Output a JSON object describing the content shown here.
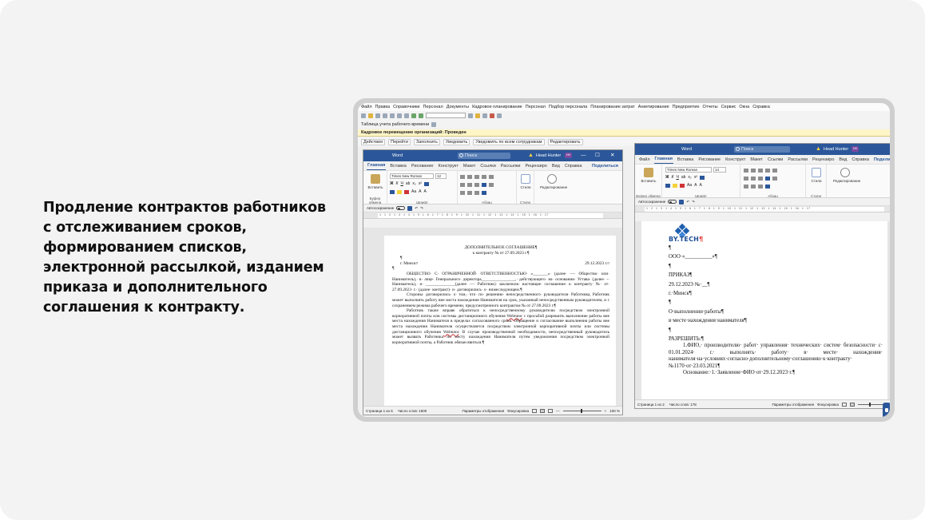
{
  "headline": "Продление контрактов работников\nс отслеживанием сроков,\nформированием списков,\nэлектронной рассылкой, изданием\nприказа и дополнительного\nсоглашения к контракту.",
  "host_app": {
    "menu": [
      "Файл",
      "Правка",
      "Справочники",
      "Персонал",
      "Документы",
      "Кадровое планирование",
      "Персонал",
      "Подбор персонала",
      "Планирование затрат",
      "Анкетирование",
      "Предприятие",
      "Отчеты",
      "Сервис",
      "Окна",
      "Справка"
    ],
    "toolbar2_label": "Таблица учета рабочего времени",
    "subwindow_title": "Кадровое перемещение организаций: Проведен",
    "subwindow_actions": [
      "Действия",
      "Перейти",
      "Заполнить",
      "Уведомить",
      "Уведомить по всем сотрудникам",
      "Редактировать"
    ]
  },
  "word_left": {
    "app_name": "Word",
    "search_placeholder": "Поиск",
    "user_name": "Head Hunter",
    "user_initials": "HH",
    "window_controls": [
      "—",
      "☐",
      "✕"
    ],
    "tabs": [
      "Главная",
      "Вставка",
      "Рисование",
      "Конструкт",
      "Макет",
      "Ссылки",
      "Рассылки",
      "Рецензиро",
      "Вид",
      "Справка"
    ],
    "share_label": "Поделиться",
    "font_name": "Times New Roman",
    "font_size": "12",
    "group_labels": {
      "clipboard": "Буфер обмена",
      "font": "Шрифт",
      "paragraph": "Абзац",
      "styles": "Стили",
      "editing": "Редактирование"
    },
    "paste_label": "Вставить",
    "styles_label": "Стили",
    "editing_label": "Редактирование",
    "autosave_label": "Автосохранение",
    "ruler_nums": "1 · 1 · 2 · 1 · 3 · 1 · 4 · 1 · 5 · 1 · 6 · 1 · 7 · 1 · 8 · 1 · 9 · 1 · 10 · 1 · 11 · 1 · 12 · 1 · 13 · 1 · 14 · 1 · 15 · 1 · 16 · 1 · 17",
    "doc": {
      "title": "ДОПОЛНИТЕЛЬНОЕ СОГЛАШЕНИЕ¶",
      "subtitle": "к контракту № от 27.09.2023 г.¶",
      "mark1": "¶",
      "city": "г. Минск¤",
      "date": "29.12.2023 г.¤",
      "mark2": "¶",
      "p1": "ОБЩЕСТВО· С· ОГРАНИЧЕННОЙ· ОТВЕТСТВЕННОСТЬЮ· «_______»· (далее· —· Общество· или· Наниматель),· в· лице· Генерального· директора________________,· действующего· на· основании· Устава· (далее· -· Наниматель),· и· ______________(далее· —· Работник)· заключили· настоящее· соглашение· к· контракту· №· от· 27.09.2023· г.· (далее· контракт)· и· договорились· о· нижеследующем.¶",
      "p2": "Стороны· договорились· о· том,· что· по· решению· непосредственного· руководителя· Работника, Работник может выполнять работу вне места нахождения Нанимателя на срок, указанный непосредственным руководителем, и с сохранением режима рабочего времени, предусмотренного контрактом № от 27.09.2023 г.¶",
      "p3_a": "Работник также вправе обратиться к непосредственному руководителю посредством электронной корпоративной почты или системы дистанционного обучения ",
      "p3_link1": "Webtutor",
      "p3_b": " с просьбой разрешить выполнение работы вне места нахождения Нанимателя в пределах согласованного срока. Обращение и согласование выполнения работы вне места нахождения Нанимателя осуществляется посредством электронной корпоративной почты или системы дистанционного обучения ",
      "p3_link2": "Webtutor",
      "p3_c": ". В случае производственной необходимости, непосредственный руководитель может вызвать Работника по месту нахождения Нанимателя путем уведомления посредством электронной корпоративной почты, а Работник обязан явиться.¶"
    },
    "status": {
      "page": "Страница 1 из 6",
      "words": "Число слов: 1600",
      "display": "Параметры отображения",
      "focus": "Фокусировка",
      "zoom_minus": "—",
      "zoom_plus": "+",
      "zoom": "100 %"
    }
  },
  "word_right": {
    "app_name": "Word",
    "search_placeholder": "Поиск",
    "user_name": "Head Hunter",
    "user_initials": "HH",
    "tabs": [
      "Файл",
      "Главная",
      "Вставка",
      "Рисование",
      "Конструкт",
      "Макет",
      "Ссылки",
      "Рассылки",
      "Рецензиро",
      "Вид",
      "Справка"
    ],
    "share_label": "Подели",
    "font_name": "Times New Roman",
    "font_size": "14",
    "group_labels": {
      "clipboard": "Буфер обмена",
      "font": "Шрифт",
      "paragraph": "Абзац",
      "styles": "Стили",
      "editing": "Редактирование"
    },
    "paste_label": "Вставить",
    "styles_label": "Стили",
    "editing_label": "Редактирование",
    "autosave_label": "Автосохранение",
    "ruler_nums": "1 · 2 · 1 · 3 · 1 · 4 · 1 · 5 · 1 · 6 · 1 · 7 · 1 · 8 · 1 · 9 · 1 · 10 · 1 · 11 · 1 · 12 · 1 · 13 · 1 · 14 · 1 · 15 · 1 · 16 · 1 · 17",
    "doc": {
      "logo": "BY.TECH",
      "logo_mark": "¶",
      "lines": [
        "¶",
        "ООО·«__________»¶",
        "¶",
        "ПРИКАЗ¶",
        "29.12.2023·№·__¶",
        "г.·Минск¶",
        "¶",
        "О·выполнении·работы¶",
        "в·месте·нахождения·нанимателя¶",
        "¶"
      ],
      "permit": "РАЗРЕШИТЬ:¶",
      "p1": "1.ФИО,· производителю· работ· управления· технических· систем· безопасности· с· 01.01.2024· г.· выполнять· работу· в· месте· нахождения· нанимателя·на·условиях·согласно·дополнительному·соглашению·к·контракту· №1170·от·23.03.2021¶",
      "basis": "Основание:·1.·Заявление·ФИО·от·29.12.2023·г.¶"
    },
    "status": {
      "page": "Страница 1 из 2",
      "words": "Число слов: 178",
      "display": "Параметры отображения",
      "focus": "Фокусировка"
    }
  }
}
